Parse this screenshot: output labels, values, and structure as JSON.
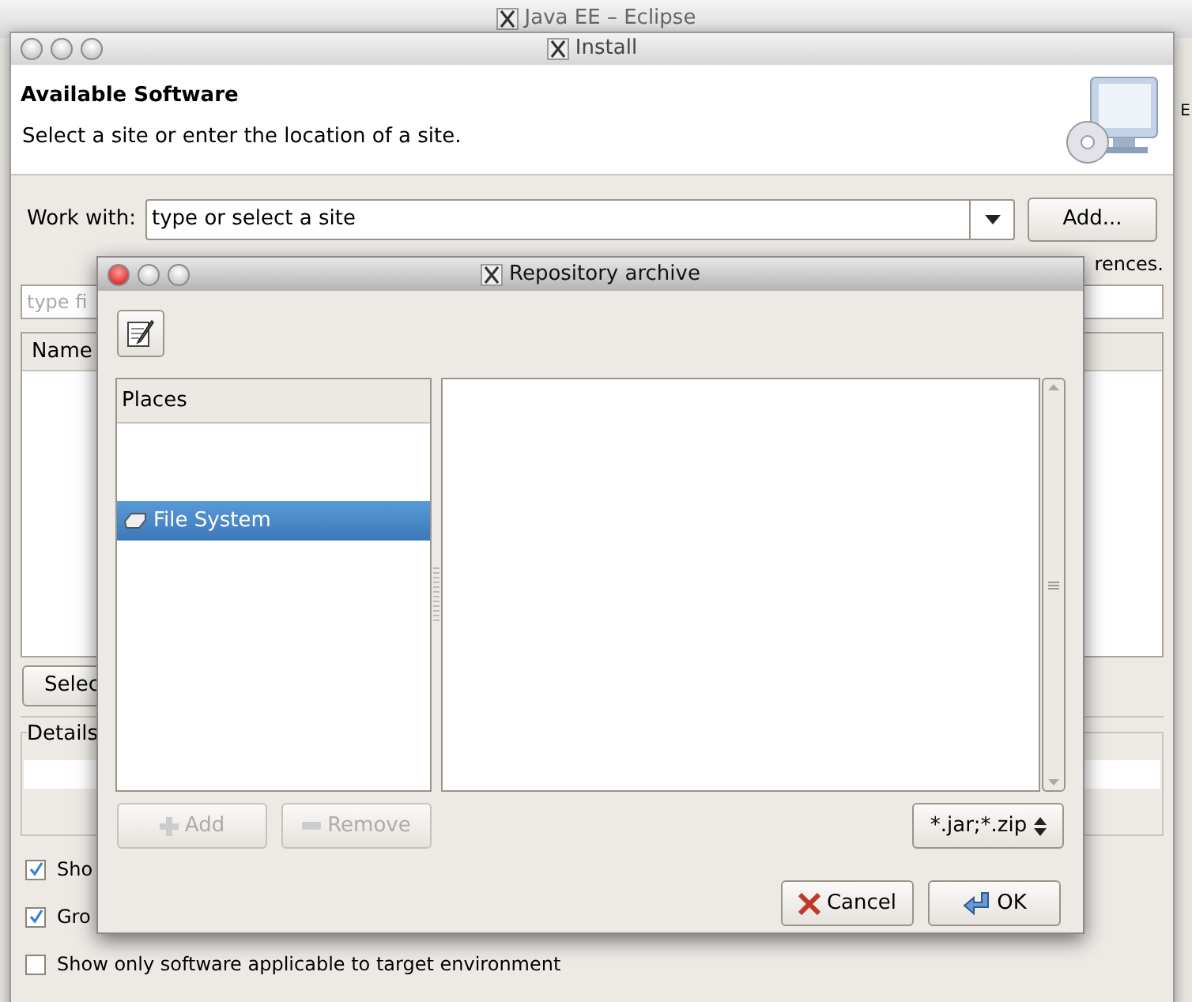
{
  "background_window": {
    "title": "Java EE – Eclipse",
    "edge_text": "E"
  },
  "install": {
    "title": "Install",
    "header": {
      "title": "Available Software",
      "subtitle": "Select a site or enter the location of a site."
    },
    "work_with": {
      "label": "Work with:",
      "value": "type or select a site",
      "add_button": "Add..."
    },
    "note": "rences.",
    "filter": {
      "placeholder": "type fi"
    },
    "table": {
      "columns": [
        "Name"
      ]
    },
    "select_button": "Selec",
    "details": {
      "label": "Details"
    },
    "options": [
      {
        "label": "Sho",
        "checked": true
      },
      {
        "label": "Gro",
        "checked": true
      },
      {
        "label": "Show only software applicable to target environment",
        "checked": false
      }
    ]
  },
  "dialog": {
    "title": "Repository archive",
    "places": {
      "header": "Places",
      "items": [
        {
          "label": "File System",
          "selected": true
        }
      ]
    },
    "add_button": {
      "label": "Add",
      "disabled": true
    },
    "remove_button": {
      "label": "Remove",
      "disabled": true
    },
    "filter": "*.jar;*.zip",
    "buttons": [
      {
        "kind": "cancel",
        "label": "Cancel"
      },
      {
        "kind": "ok",
        "label": "OK"
      }
    ]
  }
}
